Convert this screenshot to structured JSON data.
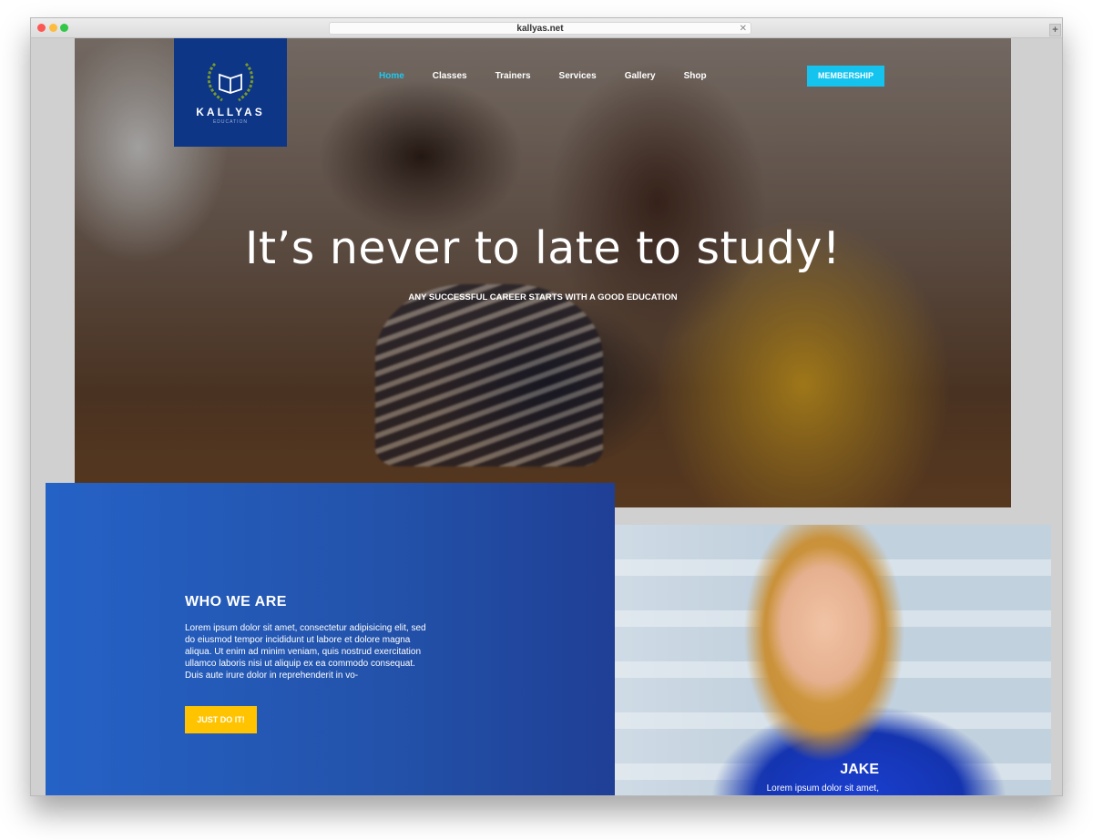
{
  "browser": {
    "url": "kallyas.net",
    "close_glyph": "✕",
    "new_tab_glyph": "+"
  },
  "logo": {
    "name": "KALLYAS",
    "subtitle": "EDUCATION"
  },
  "nav": {
    "items": [
      {
        "label": "Home",
        "active": true
      },
      {
        "label": "Classes",
        "active": false
      },
      {
        "label": "Trainers",
        "active": false
      },
      {
        "label": "Services",
        "active": false
      },
      {
        "label": "Gallery",
        "active": false
      },
      {
        "label": "Shop",
        "active": false
      }
    ],
    "membership_label": "MEMBERSHIP"
  },
  "hero": {
    "title": "It’s never to late to study!",
    "subtitle": "ANY SUCCESSFUL CAREER STARTS WITH A GOOD EDUCATION"
  },
  "who": {
    "title": "WHO WE ARE",
    "text": "Lorem ipsum dolor sit amet, consectetur adipisicing elit, sed do eiusmod tempor incididunt ut labore et dolore magna aliqua. Ut enim ad minim veniam, quis nostrud exercitation ullamco laboris nisi ut aliquip ex ea commodo consequat. Duis aute irure dolor in reprehenderit in vo-",
    "cta_label": "JUST DO IT!"
  },
  "testimonial": {
    "name": "JAKE",
    "text": "Lorem ipsum dolor sit amet, consectetur adipisicing elit, sed do eiusmod tempor incididunt"
  },
  "colors": {
    "accent": "#14c4ef",
    "brand_blue": "#0d3686",
    "section_blue": "#2352aa",
    "cta_yellow": "#ffc300"
  }
}
